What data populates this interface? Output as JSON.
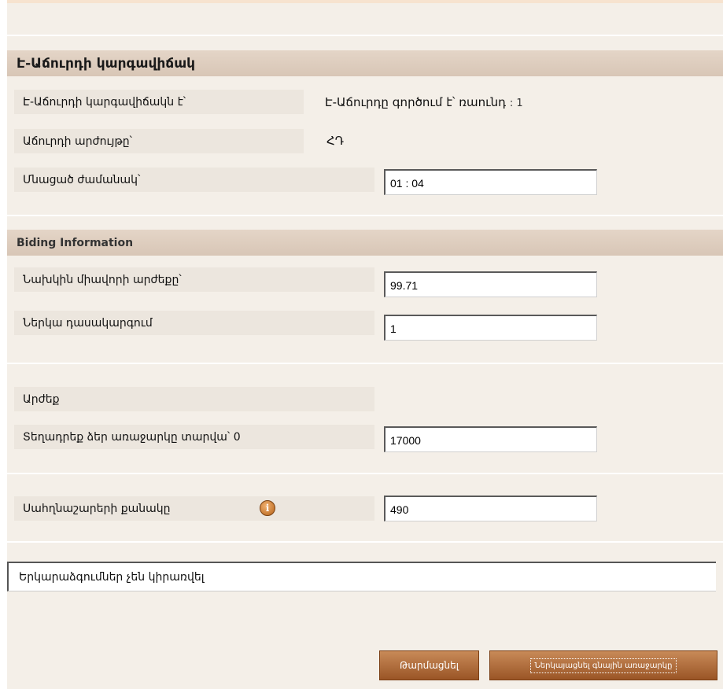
{
  "auction_status": {
    "header": "Է-Աճուրդի կարգավիճակ",
    "status_label": "Է-Աճուրդի կարգավիճակն է՝",
    "status_value": "Է-Աճուրդը գործում է՝ ռաունդ",
    "round_number": ": 1",
    "currency_label": "Աճուրդի արժույթը՝",
    "currency_value": "ՀԴ",
    "time_left_label": "Մնացած ժամանակ՝",
    "time_left_value": "01 : 04"
  },
  "bidding_information": {
    "header": "Biding Information",
    "prev_unit_price_label": "Նախկին միավորի արժեքը՝",
    "prev_unit_price_value": "99.71",
    "current_rank_label": "Ներկա դասակարգում",
    "current_rank_value": "1"
  },
  "value_section": {
    "label": "Արժեք",
    "enter_offer_label": "Տեղադրեք ձեր առաջարկը տարվա՝ 0",
    "enter_offer_value": "17000"
  },
  "quantity_section": {
    "label": "Սահղնաշարերի քանակը",
    "value": "490",
    "info_icon_glyph": "i"
  },
  "notice_text": "Երկարաձգումներ չեն կիրառվել",
  "buttons": {
    "refresh_label": "Թարմացնել",
    "submit_label": "Ներկայացնել գնային առաջարկը"
  },
  "colors": {
    "header_bg": "#dccbbd",
    "panel_bg": "#f4efe8",
    "button_bg": "#b06a36"
  }
}
